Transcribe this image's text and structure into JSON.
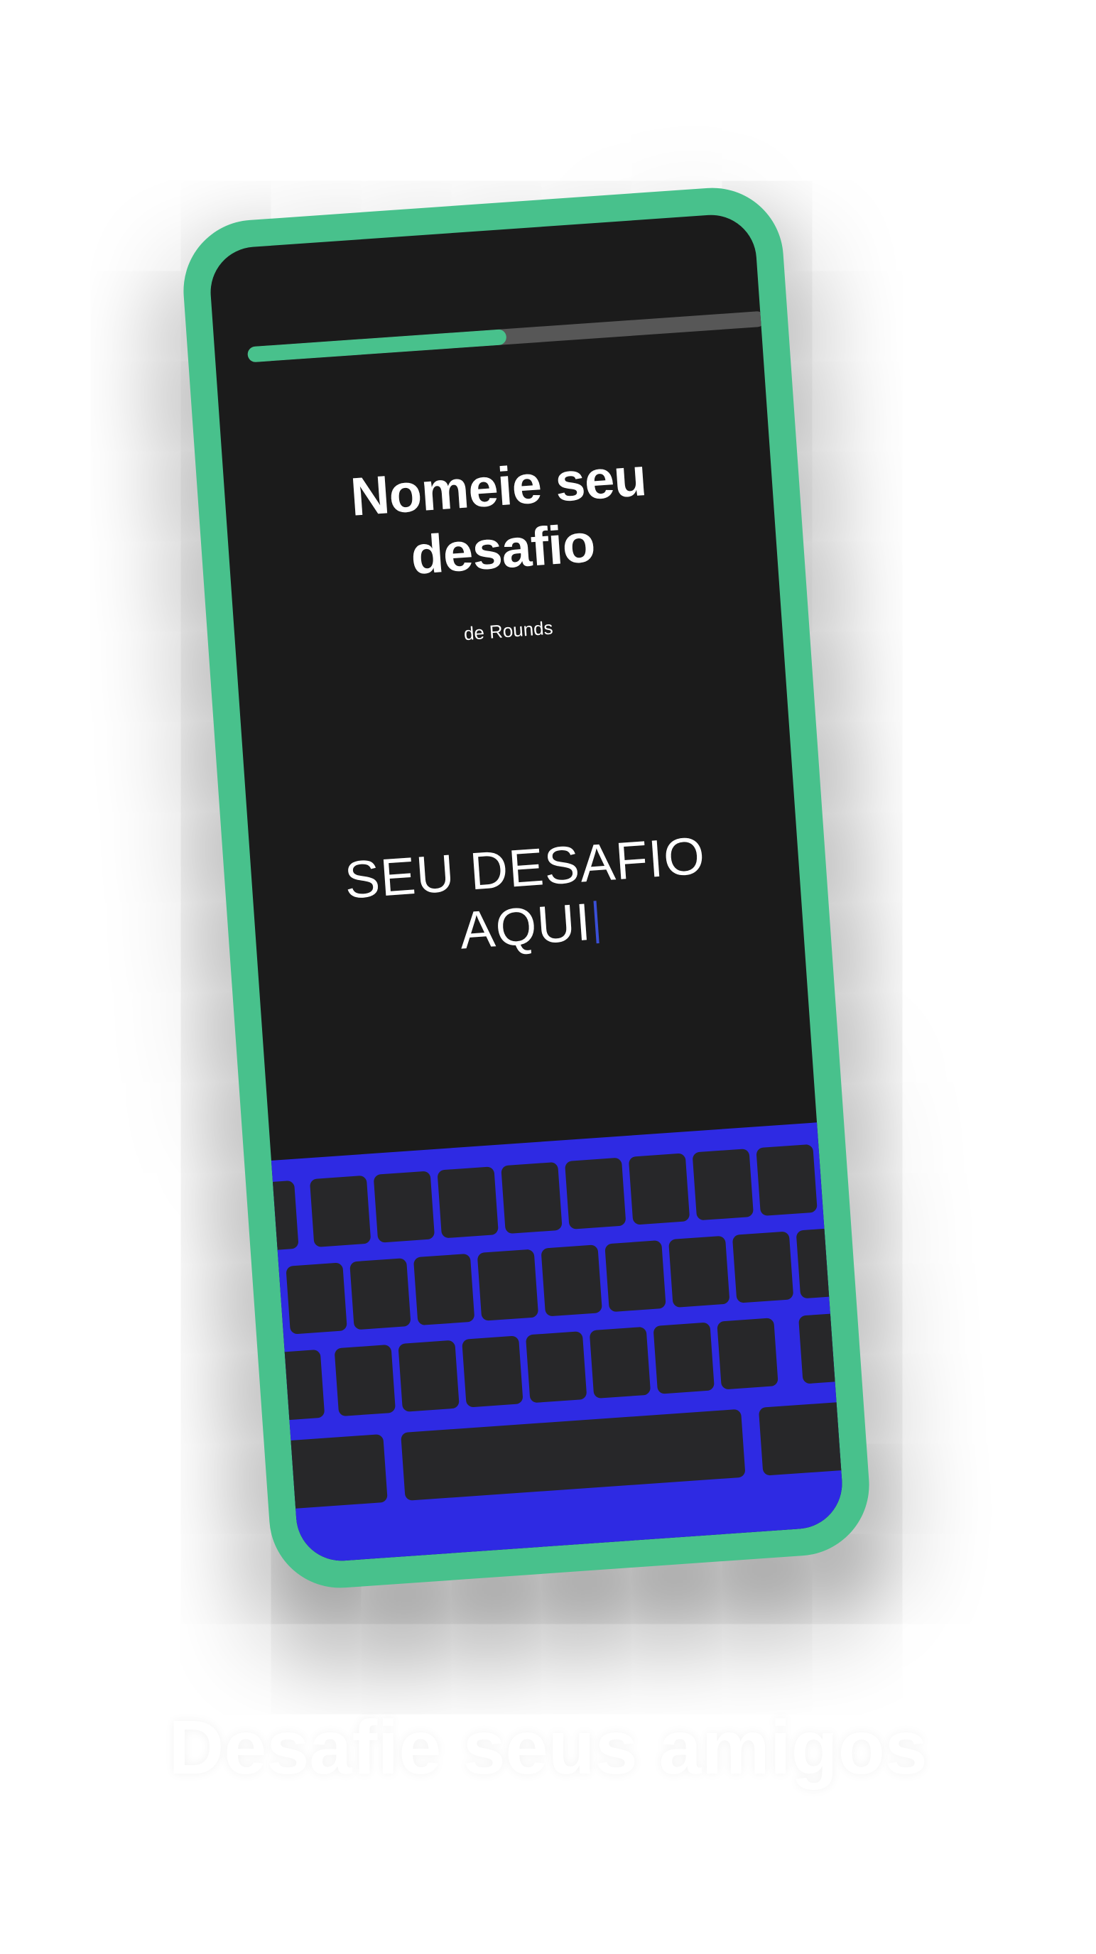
{
  "progress": {
    "fraction": 0.5,
    "fill_color": "#48c18c",
    "track_color": "#575757"
  },
  "screen": {
    "title_line1": "Nomeie seu",
    "title_line2": "desafio",
    "subtitle": "de Rounds",
    "input_line1": "SEU DESAFIO",
    "input_line2": "AQUI"
  },
  "keyboard": {
    "background_color": "#2e2ae3",
    "key_color": "#272729"
  },
  "caption": "Desafie seus amigos",
  "colors": {
    "phone_frame": "#48c18c",
    "screen_bg": "#1b1b1b",
    "caret": "#3a4fd6"
  }
}
